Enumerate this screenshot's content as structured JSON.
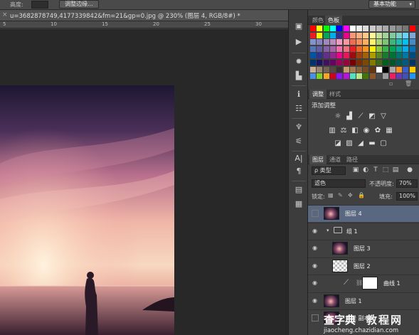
{
  "options_bar": {
    "height_label": "高度:",
    "adjust_edge_button": "调整边缘...",
    "workspace": "基本功能"
  },
  "document": {
    "tab_title": "u=3682878749,4177339842&fm=21&gp=0.jpg @ 230% (图层 4, RGB/8#) *",
    "close_glyph": "×"
  },
  "ruler": {
    "ticks": [
      "5",
      "10",
      "15",
      "20",
      "25",
      "30"
    ]
  },
  "color_panel": {
    "tabs": [
      "颜色",
      "色板"
    ],
    "active_tab": "色板"
  },
  "adjust_panel": {
    "tabs": [
      "调整",
      "样式"
    ],
    "heading": "添加调整"
  },
  "layers_panel": {
    "tabs": [
      "图层",
      "通道",
      "路径"
    ],
    "filter_kind": "ρ 类型",
    "blend_mode": "滤色",
    "opacity_label": "不透明度:",
    "opacity_value": "70%",
    "lock_label": "锁定:",
    "fill_label": "填充:",
    "fill_value": "100%",
    "layers": [
      {
        "name": "图层 4",
        "selected": true,
        "visible": false,
        "kind": "photo",
        "indent": 0
      },
      {
        "name": "组 1",
        "selected": false,
        "visible": true,
        "kind": "group",
        "indent": 0
      },
      {
        "name": "图层 3",
        "selected": false,
        "visible": true,
        "kind": "photo",
        "indent": 1
      },
      {
        "name": "图层 2",
        "selected": false,
        "visible": true,
        "kind": "transparent",
        "indent": 1
      },
      {
        "name": "曲线 1",
        "selected": false,
        "visible": true,
        "kind": "curves",
        "indent": 1
      },
      {
        "name": "图层 1",
        "selected": false,
        "visible": true,
        "kind": "photo",
        "indent": 0
      },
      {
        "name": "背景 副本",
        "selected": false,
        "visible": false,
        "kind": "photo",
        "indent": 0
      }
    ]
  },
  "watermark": {
    "brand": "查字典",
    "section": "教程网",
    "url": "jiaocheng.chazidian.com"
  }
}
